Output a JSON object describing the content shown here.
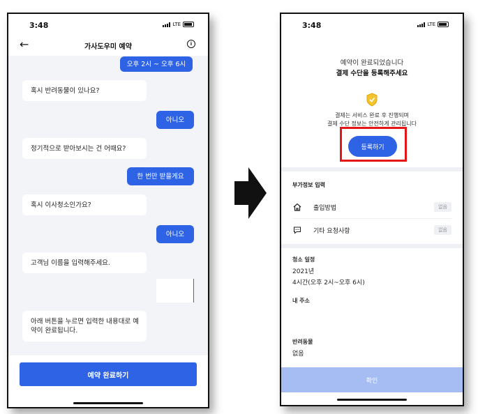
{
  "left": {
    "status": {
      "time": "3:48",
      "network": "LTE"
    },
    "header": {
      "back_icon": "←",
      "title": "가사도우미 예약",
      "info_icon": "i"
    },
    "chat": {
      "messages": [
        {
          "from": "user",
          "text": "오후 2시 ~ 오후 6시"
        },
        {
          "from": "bot",
          "text": "혹시 반려동물이 있나요?"
        },
        {
          "from": "user",
          "text": "아니오"
        },
        {
          "from": "bot",
          "text": "정기적으로 받아보시는 건 어때요?"
        },
        {
          "from": "user",
          "text": "한 번만 받을게요"
        },
        {
          "from": "bot",
          "text": "혹시 이사청소인가요?"
        },
        {
          "from": "user",
          "text": "아니오"
        },
        {
          "from": "bot",
          "text": "고객님 이름을 입력해주세요."
        },
        {
          "from": "user",
          "text": ""
        },
        {
          "from": "bot",
          "text": "아래 버튼을 누르면 입력한 내용대로 예약이 완료됩니다."
        }
      ]
    },
    "footer": {
      "complete_label": "예약 완료하기"
    }
  },
  "right": {
    "status": {
      "time": "3:48",
      "network": "LTE"
    },
    "top": {
      "line1": "예약이 완료되었습니다",
      "line2": "결제 수단을 등록해주세요",
      "note1": "결제는 서비스 완료 후 진행되며",
      "note2": "결제 수단 정보는 안전하게 관리됩니다",
      "register_label": "등록하기"
    },
    "extra": {
      "title": "부가정보 입력",
      "rows": [
        {
          "icon": "home-icon",
          "label": "출입방법",
          "tag": "없음"
        },
        {
          "icon": "message-icon",
          "label": "기타 요청사항",
          "tag": "없음"
        }
      ]
    },
    "summary": {
      "schedule_label": "청소 일정",
      "schedule_year": "2021년",
      "schedule_time": "4시간(오후 2시~오후 6시)",
      "address_label": "내 주소",
      "pet_label": "반려동물",
      "pet_value": "없음"
    },
    "confirm_label": "확인"
  },
  "colors": {
    "accent": "#2e63e6",
    "highlight": "#e41515",
    "confirm_disabled": "#a5bdf3",
    "chat_bg": "#f3f4f8"
  }
}
